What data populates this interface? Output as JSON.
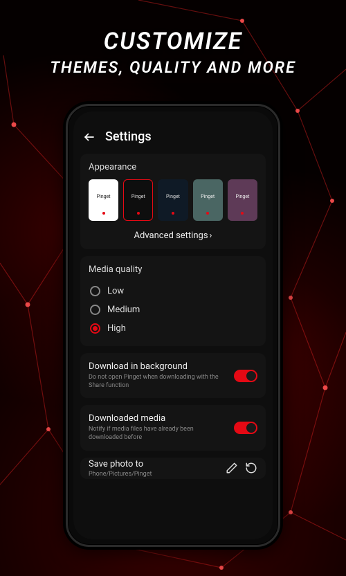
{
  "promo": {
    "line1": "CUSTOMIZE",
    "line2": "THEMES, QUALITY AND MORE"
  },
  "header": {
    "title": "Settings"
  },
  "appearance": {
    "title": "Appearance",
    "themes": [
      {
        "label": "Pinget",
        "bg": "#ffffff",
        "fg": "#222222",
        "selected": false
      },
      {
        "label": "Pinget",
        "bg": "#0e0e0e",
        "fg": "#dddddd",
        "selected": true
      },
      {
        "label": "Pinget",
        "bg": "#0f1a26",
        "fg": "#dddddd",
        "selected": false
      },
      {
        "label": "Pinget",
        "bg": "#4a6663",
        "fg": "#eeeeee",
        "selected": false
      },
      {
        "label": "Pinget",
        "bg": "#5e3a57",
        "fg": "#eeeeee",
        "selected": false
      }
    ],
    "advanced_label": "Advanced settings",
    "advanced_chevron": "›"
  },
  "media_quality": {
    "title": "Media quality",
    "options": [
      {
        "label": "Low",
        "checked": false
      },
      {
        "label": "Medium",
        "checked": false
      },
      {
        "label": "High",
        "checked": true
      }
    ]
  },
  "download_bg": {
    "title": "Download in background",
    "subtitle": "Do not open Pinget when downloading with the Share function",
    "on": true
  },
  "downloaded_media": {
    "title": "Downloaded media",
    "subtitle": "Notify if media files have already been downloaded before",
    "on": true
  },
  "save_photo": {
    "title": "Save photo to",
    "path": "Phone/Pictures/Pinget"
  }
}
